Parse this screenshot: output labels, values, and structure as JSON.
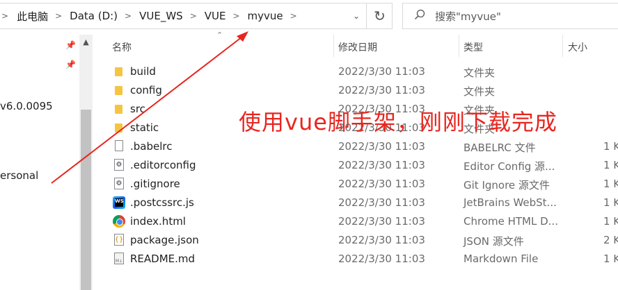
{
  "address_bar": {
    "breadcrumbs": [
      "此电脑",
      "Data (D:)",
      "VUE_WS",
      "VUE",
      "myvue"
    ]
  },
  "search": {
    "placeholder": "搜索\"myvue\""
  },
  "nav": {
    "items": [
      {
        "label": "v6.0.0095"
      },
      {
        "label": "ersonal"
      }
    ]
  },
  "columns": {
    "name": "名称",
    "date": "修改日期",
    "type": "类型",
    "size": "大小"
  },
  "files": [
    {
      "name": "build",
      "date": "2022/3/30 11:03",
      "type": "文件夹",
      "size": "",
      "icon": "folder-icon"
    },
    {
      "name": "config",
      "date": "2022/3/30 11:03",
      "type": "文件夹",
      "size": "",
      "icon": "folder-icon"
    },
    {
      "name": "src",
      "date": "2022/3/30 11:03",
      "type": "文件夹",
      "size": "",
      "icon": "folder-icon"
    },
    {
      "name": "static",
      "date": "2022/3/30 11:03",
      "type": "文件夹",
      "size": "",
      "icon": "folder-icon"
    },
    {
      "name": ".babelrc",
      "date": "2022/3/30 11:03",
      "type": "BABELRC 文件",
      "size": "1 K",
      "icon": "file-icon"
    },
    {
      "name": ".editorconfig",
      "date": "2022/3/30 11:03",
      "type": "Editor Config 源...",
      "size": "1 K",
      "icon": "config-file-icon"
    },
    {
      "name": ".gitignore",
      "date": "2022/3/30 11:03",
      "type": "Git Ignore 源文件",
      "size": "1 K",
      "icon": "config-file-icon"
    },
    {
      "name": ".postcssrc.js",
      "date": "2022/3/30 11:03",
      "type": "JetBrains WebSt...",
      "size": "1 K",
      "icon": "webstorm-icon"
    },
    {
      "name": "index.html",
      "date": "2022/3/30 11:03",
      "type": "Chrome HTML D...",
      "size": "1 K",
      "icon": "chrome-icon"
    },
    {
      "name": "package.json",
      "date": "2022/3/30 11:03",
      "type": "JSON 源文件",
      "size": "2 K",
      "icon": "json-file-icon"
    },
    {
      "name": "README.md",
      "date": "2022/3/30 11:03",
      "type": "Markdown File",
      "size": "1 K",
      "icon": "markdown-file-icon"
    }
  ],
  "annotation": {
    "text": "使用vue脚手架，刚刚下载完成",
    "color": "#e8251f"
  }
}
